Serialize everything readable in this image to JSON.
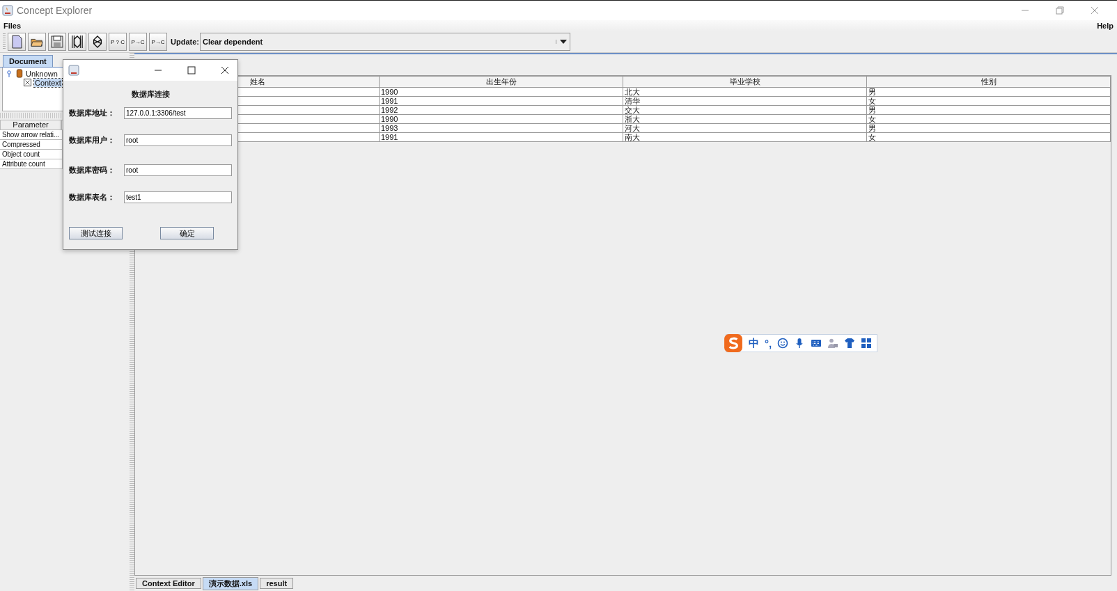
{
  "window": {
    "title": "Concept Explorer"
  },
  "menu": [
    {
      "label": "Files"
    },
    {
      "label": "Help"
    }
  ],
  "toolbar": [
    {
      "kind": "new"
    },
    {
      "kind": "open"
    },
    {
      "kind": "save"
    },
    {
      "kind": "lattice"
    },
    {
      "kind": "diamond"
    },
    {
      "kind": "text",
      "label": "P ? C"
    },
    {
      "kind": "text",
      "label": "P→C"
    },
    {
      "kind": "text",
      "label": "P→C"
    }
  ],
  "update": {
    "label": "Update:",
    "value": "Clear dependent"
  },
  "document_tab": "Document",
  "tree": [
    {
      "label": "Unknown",
      "expanded": true,
      "children": [
        {
          "label": "Context",
          "selected": true
        }
      ]
    }
  ],
  "parameters": {
    "column": "Parameter",
    "rows": [
      "Show arrow relati...",
      "Compressed",
      "Object count",
      "Attribute count"
    ]
  },
  "table": {
    "columns": [
      "姓名",
      "出生年份",
      "毕业学校",
      "性别"
    ],
    "rows": [
      [
        "",
        "1990",
        "北大",
        "男"
      ],
      [
        "",
        "1991",
        "清华",
        "女"
      ],
      [
        "",
        "1992",
        "交大",
        "男"
      ],
      [
        "",
        "1990",
        "浙大",
        "女"
      ],
      [
        "",
        "1993",
        "河大",
        "男"
      ],
      [
        "",
        "1991",
        "南大",
        "女"
      ]
    ]
  },
  "bottom_tabs": [
    {
      "label": "Context Editor",
      "selected": false
    },
    {
      "label": "演示数据.xls",
      "selected": true
    },
    {
      "label": "result",
      "selected": false
    }
  ],
  "dialog": {
    "heading": "数据库连接",
    "fields": [
      {
        "label": "数据库地址：",
        "value": "127.0.0.1:3306/test"
      },
      {
        "label": "数据库用户：",
        "value": "root"
      },
      {
        "label": "数据库密码：",
        "value": "root"
      },
      {
        "label": "数据库表名：",
        "value": "test1"
      }
    ],
    "buttons": [
      "测试连接",
      "确定"
    ]
  },
  "ime": {
    "texts": [
      "中",
      "°,"
    ]
  }
}
